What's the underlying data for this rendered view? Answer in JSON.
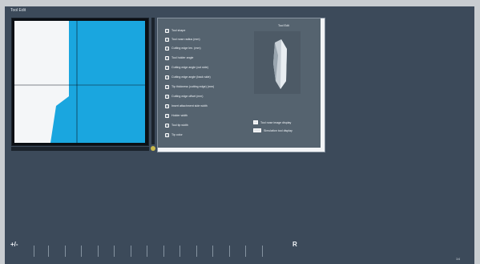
{
  "window": {
    "title": "Tool Edit"
  },
  "list": {
    "options": [
      {
        "label": "Tool shape",
        "icon": "shape-icon"
      },
      {
        "label": "Tool nose radius (mm)",
        "icon": "radius-icon"
      },
      {
        "label": "Cutting edge len. (mm)",
        "icon": "edge-icon"
      },
      {
        "label": "Tool holder angle",
        "icon": "angle-icon"
      },
      {
        "label": "Cutting edge angle (cut side)",
        "icon": "angle-icon"
      },
      {
        "label": "Cutting edge angle (back side)",
        "icon": "angle-icon"
      },
      {
        "label": "Tip thickness (cutting edge) (mm)",
        "icon": "thickness-icon"
      },
      {
        "label": "Cutting edge offset (mm)",
        "icon": "offset-icon"
      },
      {
        "label": "Insert attachment side width",
        "icon": "width-icon"
      },
      {
        "label": "Holder width",
        "icon": "holder-icon"
      },
      {
        "label": "Tool tip width",
        "icon": "tip-icon"
      },
      {
        "label": "Tip color",
        "icon": "color-icon"
      }
    ],
    "tool_image_label": "Tool Edit",
    "checkbox_a": "Tool nose image display",
    "checkbox_b": "Simulation tool display"
  },
  "toolbar": {
    "left_icon": "+/-",
    "right_icon": "R",
    "page": "1/4"
  }
}
